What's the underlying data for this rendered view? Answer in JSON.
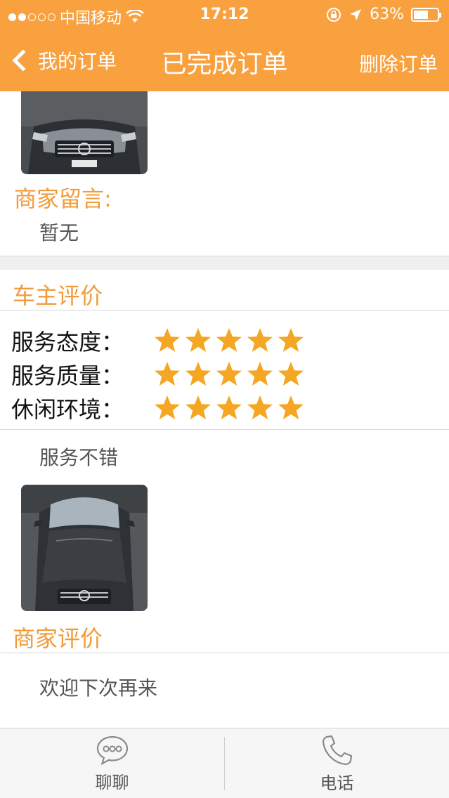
{
  "status_bar": {
    "carrier": "中国移动",
    "time": "17:12",
    "battery": "63%",
    "battery_level": 0.63,
    "signal_filled": 2,
    "signal_total": 5
  },
  "navbar": {
    "back_label": "我的订单",
    "title": "已完成订单",
    "right_action": "删除订单"
  },
  "merchant_message": {
    "heading": "商家留言:",
    "text": "暂无"
  },
  "owner_review": {
    "heading": "车主评价",
    "ratings": [
      {
        "label": "服务态度：",
        "stars": 5
      },
      {
        "label": "服务质量：",
        "stars": 5
      },
      {
        "label": "休闲环境：",
        "stars": 5
      }
    ],
    "comment": "服务不错"
  },
  "merchant_review": {
    "heading": "商家评价",
    "text": "欢迎下次再来"
  },
  "bottom_bar": {
    "chat_label": "聊聊",
    "phone_label": "电话"
  },
  "colors": {
    "accent": "#f9a13f",
    "heading_orange": "#f19b3a",
    "star": "#f5a623"
  }
}
